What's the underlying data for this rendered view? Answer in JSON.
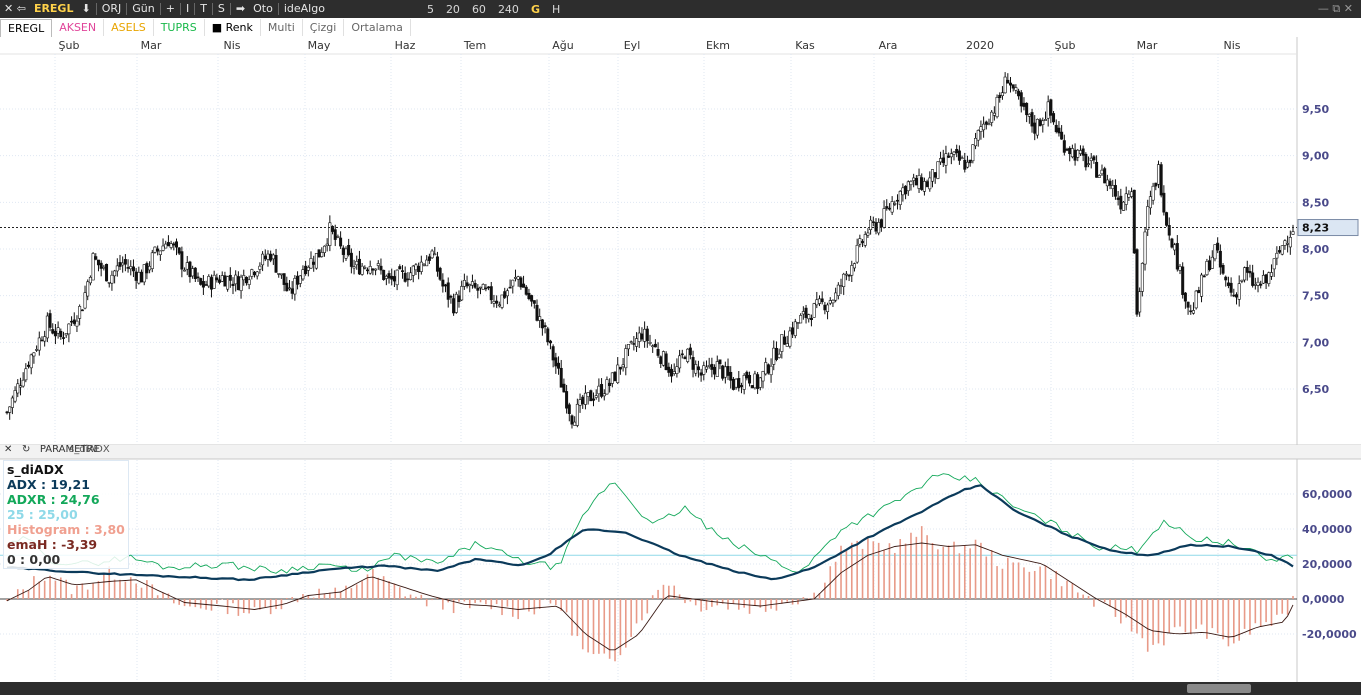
{
  "toolbar": {
    "arrows": "✕  ⇦",
    "symbol": "EREGL",
    "down_icon": "⬇",
    "orj": "ORJ",
    "gun": "Gün",
    "plus": "+",
    "tool_i": "I",
    "tool_t": "T",
    "tool_s": "S",
    "arrow_right": "➡",
    "oto": "Oto",
    "idealgo": "ideAlgo",
    "periods": [
      "5",
      "20",
      "60",
      "240",
      "G",
      "H"
    ],
    "window_controls": "—  ⧉  ✕"
  },
  "tabs": [
    {
      "label": "EREGL",
      "color": "#000000"
    },
    {
      "label": "AKSEN",
      "color": "#e0459a"
    },
    {
      "label": "ASELS",
      "color": "#e8a400"
    },
    {
      "label": "TUPRS",
      "color": "#19b84a"
    },
    {
      "label": "■ Renk",
      "color": "#333333"
    },
    {
      "label": "Multi",
      "color": "#666666"
    },
    {
      "label": "Çizgi",
      "color": "#666666"
    },
    {
      "label": "Ortalama",
      "color": "#666666"
    }
  ],
  "chart_data": [
    {
      "type": "candlestick",
      "x_labels": [
        "Şub",
        "Mar",
        "Nis",
        "May",
        "Haz",
        "Tem",
        "Ağu",
        "Eyl",
        "Ekm",
        "Kas",
        "Ara",
        "2020",
        "Şub",
        "Mar",
        "Nis"
      ],
      "y_ticks": [
        6.5,
        7.0,
        7.5,
        8.0,
        8.5,
        9.0,
        9.5
      ],
      "ylim": [
        5.95,
        10.15
      ],
      "last_price": "8,23",
      "close_path": [
        [
          0,
          6.25
        ],
        [
          8,
          6.8
        ],
        [
          15,
          7.2
        ],
        [
          20,
          7.05
        ],
        [
          28,
          7.4
        ],
        [
          32,
          7.9
        ],
        [
          38,
          7.7
        ],
        [
          43,
          7.85
        ],
        [
          50,
          7.7
        ],
        [
          55,
          7.95
        ],
        [
          60,
          8.1
        ],
        [
          65,
          7.85
        ],
        [
          72,
          7.6
        ],
        [
          80,
          7.7
        ],
        [
          86,
          7.65
        ],
        [
          92,
          7.8
        ],
        [
          98,
          7.95
        ],
        [
          105,
          7.5
        ],
        [
          110,
          7.8
        ],
        [
          116,
          7.95
        ],
        [
          120,
          8.2
        ],
        [
          124,
          8.0
        ],
        [
          129,
          7.8
        ],
        [
          136,
          7.85
        ],
        [
          142,
          7.65
        ],
        [
          150,
          7.75
        ],
        [
          158,
          7.95
        ],
        [
          162,
          7.6
        ],
        [
          166,
          7.4
        ],
        [
          170,
          7.6
        ],
        [
          176,
          7.55
        ],
        [
          183,
          7.45
        ],
        [
          190,
          7.7
        ],
        [
          197,
          7.3
        ],
        [
          200,
          7.1
        ],
        [
          204,
          6.75
        ],
        [
          210,
          6.2
        ],
        [
          216,
          6.4
        ],
        [
          224,
          6.55
        ],
        [
          230,
          6.85
        ],
        [
          236,
          7.1
        ],
        [
          242,
          6.9
        ],
        [
          248,
          6.65
        ],
        [
          252,
          6.9
        ],
        [
          258,
          6.65
        ],
        [
          264,
          6.75
        ],
        [
          270,
          6.55
        ],
        [
          275,
          6.65
        ],
        [
          279,
          6.55
        ],
        [
          284,
          6.8
        ],
        [
          288,
          7.0
        ],
        [
          295,
          7.25
        ],
        [
          300,
          7.35
        ],
        [
          308,
          7.5
        ],
        [
          314,
          7.85
        ],
        [
          320,
          8.2
        ],
        [
          325,
          8.3
        ],
        [
          330,
          8.55
        ],
        [
          335,
          8.7
        ],
        [
          342,
          8.7
        ],
        [
          350,
          9.0
        ],
        [
          357,
          8.9
        ],
        [
          362,
          9.3
        ],
        [
          368,
          9.55
        ],
        [
          372,
          9.85
        ],
        [
          377,
          9.5
        ],
        [
          382,
          9.3
        ],
        [
          387,
          9.5
        ],
        [
          392,
          9.15
        ],
        [
          398,
          9.0
        ],
        [
          405,
          8.85
        ],
        [
          410,
          8.7
        ],
        [
          414,
          8.5
        ],
        [
          418,
          8.7
        ],
        [
          420,
          7.3
        ],
        [
          424,
          8.4
        ],
        [
          428,
          8.85
        ],
        [
          431,
          8.3
        ],
        [
          434,
          8.0
        ],
        [
          437,
          7.6
        ],
        [
          440,
          7.3
        ],
        [
          443,
          7.55
        ],
        [
          446,
          7.8
        ],
        [
          449,
          8.0
        ],
        [
          452,
          7.7
        ],
        [
          456,
          7.5
        ],
        [
          460,
          7.75
        ],
        [
          464,
          7.6
        ],
        [
          468,
          7.65
        ],
        [
          472,
          7.9
        ],
        [
          475,
          8.1
        ],
        [
          478,
          8.23
        ]
      ],
      "n_candles": 479,
      "seed": 7
    },
    {
      "type": "indicator",
      "title": "s_diADX",
      "y_ticks": [
        "60,0000",
        "40,0000",
        "20,0000",
        "0,0000",
        "-20,0000"
      ],
      "ylim": [
        -38,
        73
      ],
      "adx_path": [
        [
          0,
          18
        ],
        [
          30,
          15
        ],
        [
          60,
          13
        ],
        [
          90,
          11
        ],
        [
          120,
          17
        ],
        [
          140,
          19
        ],
        [
          160,
          16
        ],
        [
          175,
          23
        ],
        [
          190,
          19
        ],
        [
          200,
          24
        ],
        [
          215,
          40
        ],
        [
          230,
          38
        ],
        [
          250,
          25
        ],
        [
          270,
          16
        ],
        [
          285,
          11
        ],
        [
          300,
          18
        ],
        [
          320,
          35
        ],
        [
          340,
          50
        ],
        [
          355,
          62
        ],
        [
          362,
          65
        ],
        [
          375,
          50
        ],
        [
          395,
          36
        ],
        [
          412,
          27
        ],
        [
          425,
          25
        ],
        [
          440,
          31
        ],
        [
          455,
          30
        ],
        [
          470,
          25
        ],
        [
          478,
          19
        ]
      ],
      "adxr_path": [
        [
          0,
          30
        ],
        [
          8,
          35
        ],
        [
          15,
          22
        ],
        [
          30,
          20
        ],
        [
          45,
          24
        ],
        [
          60,
          18
        ],
        [
          80,
          20
        ],
        [
          100,
          16
        ],
        [
          120,
          20
        ],
        [
          130,
          15
        ],
        [
          145,
          25
        ],
        [
          160,
          20
        ],
        [
          175,
          32
        ],
        [
          190,
          22
        ],
        [
          205,
          18
        ],
        [
          215,
          50
        ],
        [
          225,
          68
        ],
        [
          240,
          42
        ],
        [
          252,
          52
        ],
        [
          265,
          35
        ],
        [
          280,
          25
        ],
        [
          295,
          15
        ],
        [
          310,
          40
        ],
        [
          330,
          55
        ],
        [
          345,
          70
        ],
        [
          360,
          68
        ],
        [
          375,
          52
        ],
        [
          390,
          42
        ],
        [
          405,
          30
        ],
        [
          420,
          28
        ],
        [
          430,
          45
        ],
        [
          440,
          35
        ],
        [
          455,
          32
        ],
        [
          470,
          22
        ],
        [
          478,
          25
        ]
      ],
      "hist_path": [
        [
          0,
          -3
        ],
        [
          8,
          8
        ],
        [
          15,
          15
        ],
        [
          25,
          5
        ],
        [
          38,
          15
        ],
        [
          48,
          12
        ],
        [
          56,
          3
        ],
        [
          66,
          -5
        ],
        [
          80,
          -4
        ],
        [
          92,
          -8
        ],
        [
          103,
          -2
        ],
        [
          112,
          4
        ],
        [
          124,
          3
        ],
        [
          135,
          15
        ],
        [
          145,
          6
        ],
        [
          157,
          -2
        ],
        [
          170,
          -5
        ],
        [
          180,
          -4
        ],
        [
          190,
          -8
        ],
        [
          205,
          -2
        ],
        [
          215,
          -32
        ],
        [
          225,
          -36
        ],
        [
          235,
          -12
        ],
        [
          245,
          12
        ],
        [
          255,
          -4
        ],
        [
          265,
          -3
        ],
        [
          280,
          -6
        ],
        [
          290,
          -1
        ],
        [
          300,
          2
        ],
        [
          310,
          28
        ],
        [
          320,
          32
        ],
        [
          330,
          30
        ],
        [
          340,
          38
        ],
        [
          350,
          28
        ],
        [
          360,
          32
        ],
        [
          370,
          20
        ],
        [
          385,
          18
        ],
        [
          395,
          8
        ],
        [
          405,
          -3
        ],
        [
          415,
          -12
        ],
        [
          425,
          -28
        ],
        [
          435,
          -18
        ],
        [
          445,
          -18
        ],
        [
          455,
          -26
        ],
        [
          465,
          -15
        ],
        [
          475,
          -12
        ],
        [
          478,
          4
        ]
      ],
      "emah_path": [
        [
          0,
          -1
        ],
        [
          8,
          5
        ],
        [
          15,
          13
        ],
        [
          25,
          8
        ],
        [
          38,
          10
        ],
        [
          48,
          11
        ],
        [
          56,
          5
        ],
        [
          66,
          -2
        ],
        [
          80,
          -4
        ],
        [
          92,
          -6
        ],
        [
          103,
          -3
        ],
        [
          112,
          2
        ],
        [
          124,
          4
        ],
        [
          135,
          13
        ],
        [
          145,
          8
        ],
        [
          157,
          2
        ],
        [
          170,
          -3
        ],
        [
          180,
          -4
        ],
        [
          190,
          -6
        ],
        [
          205,
          -4
        ],
        [
          215,
          -20
        ],
        [
          225,
          -30
        ],
        [
          235,
          -20
        ],
        [
          245,
          2
        ],
        [
          255,
          0
        ],
        [
          265,
          -2
        ],
        [
          280,
          -4
        ],
        [
          290,
          -2
        ],
        [
          300,
          0
        ],
        [
          310,
          15
        ],
        [
          320,
          25
        ],
        [
          330,
          30
        ],
        [
          340,
          32
        ],
        [
          350,
          30
        ],
        [
          360,
          31
        ],
        [
          370,
          25
        ],
        [
          385,
          20
        ],
        [
          395,
          10
        ],
        [
          405,
          0
        ],
        [
          415,
          -8
        ],
        [
          425,
          -18
        ],
        [
          435,
          -20
        ],
        [
          445,
          -19
        ],
        [
          455,
          -22
        ],
        [
          465,
          -16
        ],
        [
          475,
          -13
        ],
        [
          478,
          -3.39
        ]
      ],
      "level_25": 25,
      "level_0": 0
    }
  ],
  "indicator_panel": {
    "param_label": "PARAMETRE",
    "name_label": "s_diADX",
    "legend_title": "s_diADX",
    "rows": [
      {
        "label": "ADX :  19,21",
        "color": "#0b3a5a"
      },
      {
        "label": "ADXR :  24,76",
        "color": "#13a85a"
      },
      {
        "label": "25 :  25,00",
        "color": "#8fd9e8"
      },
      {
        "label": "Histogram :  3,80",
        "color": "#f0a090"
      },
      {
        "label": "emaH :  -3,39",
        "color": "#7a2a22"
      },
      {
        "label": "0 :  0,00",
        "color": "#333333"
      }
    ]
  },
  "colors": {
    "accent": "#ffd24a",
    "adx": "#0b3a5a",
    "adxr": "#13a85a",
    "level25": "#8fd9e8",
    "histogram": "#e89a88",
    "emah": "#3a1a14",
    "axis_text": "#4a4a8a"
  }
}
